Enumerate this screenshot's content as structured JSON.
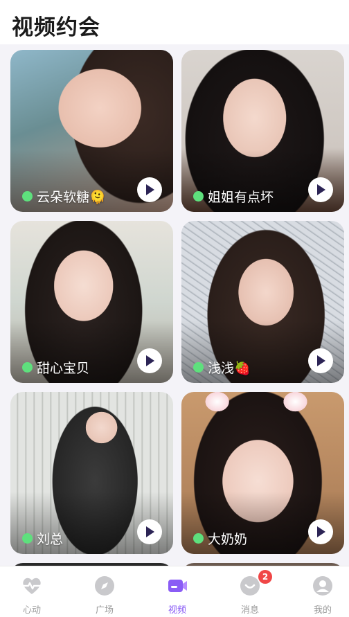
{
  "header": {
    "title": "视频约会"
  },
  "cards": [
    {
      "name": "云朵软糖🫠",
      "online": true
    },
    {
      "name": "姐姐有点坏",
      "online": true
    },
    {
      "name": "甜心宝贝",
      "online": true
    },
    {
      "name": "浅浅🍓",
      "online": true
    },
    {
      "name": "刘总",
      "online": true
    },
    {
      "name": "大奶奶",
      "online": true
    }
  ],
  "tabbar": {
    "items": [
      {
        "label": "心动",
        "icon": "heartbeat-icon"
      },
      {
        "label": "广场",
        "icon": "compass-icon"
      },
      {
        "label": "视频",
        "icon": "video-camera-icon",
        "active": true
      },
      {
        "label": "消息",
        "icon": "message-icon",
        "badge": "2"
      },
      {
        "label": "我的",
        "icon": "profile-icon"
      }
    ]
  },
  "colors": {
    "accent": "#8a5cf5",
    "online": "#5ee07d",
    "badge": "#f04646"
  }
}
